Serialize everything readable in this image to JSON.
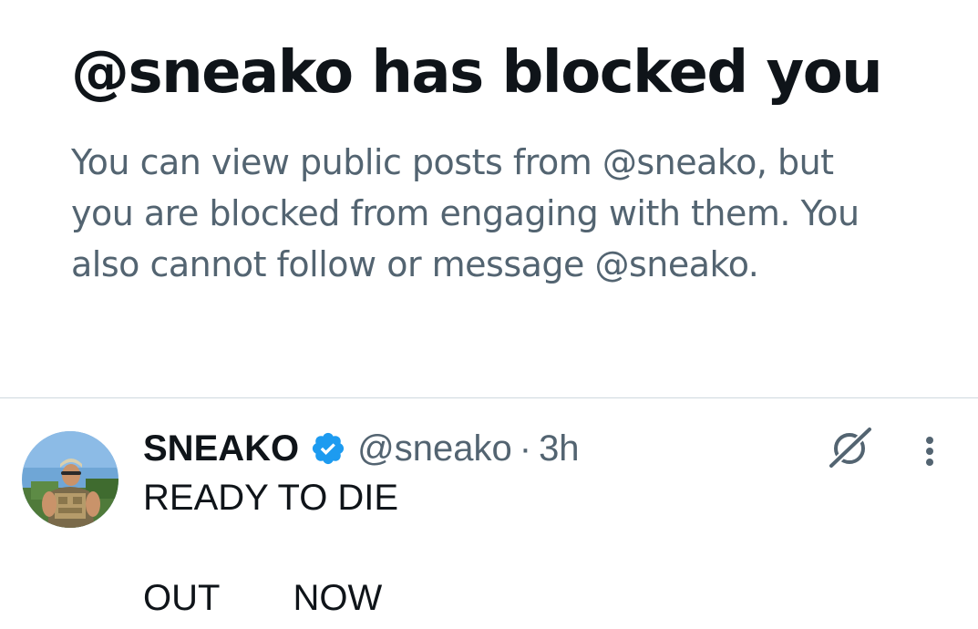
{
  "blocked": {
    "title": "@sneako has blocked you",
    "description": "You can view public posts from @sneako, but you are blocked from engaging with them. You also cannot follow or message @sneako."
  },
  "post": {
    "display_name": "SNEAKO",
    "verified": true,
    "handle": "@sneako",
    "separator": "·",
    "time": "3h",
    "text_line1": "READY TO DIE",
    "text_word1": "OUT",
    "text_word2": "NOW",
    "icons": [
      "verified-badge-icon",
      "grok-icon",
      "more-options-icon"
    ]
  },
  "colors": {
    "text_primary": "#0f1419",
    "text_secondary": "#536471",
    "verified_blue": "#1d9bf0",
    "divider": "#cfd9de"
  }
}
